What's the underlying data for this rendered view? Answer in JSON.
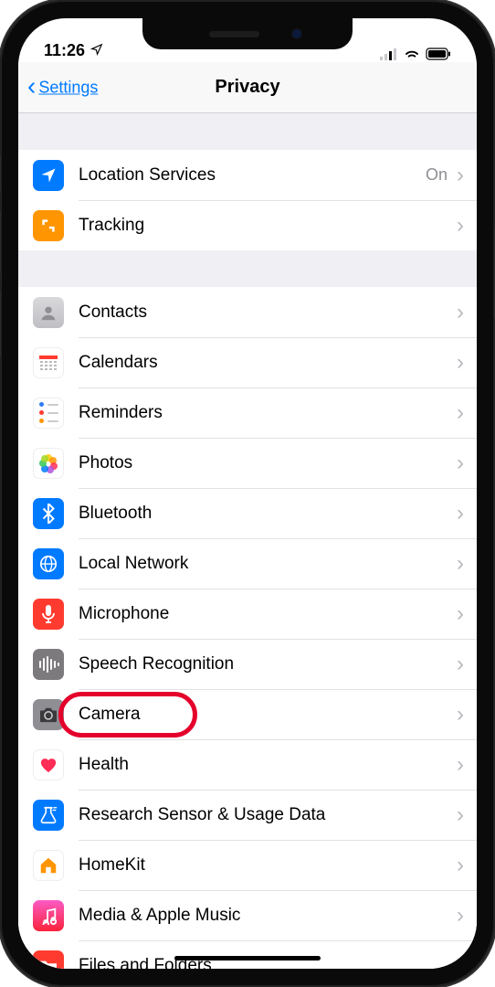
{
  "status": {
    "time": "11:26"
  },
  "nav": {
    "back_label": "Settings",
    "title": "Privacy"
  },
  "groups": [
    {
      "rows": [
        {
          "id": "location-services",
          "icon": "location-arrow-icon",
          "label": "Location Services",
          "value": "On"
        },
        {
          "id": "tracking",
          "icon": "tracking-icon",
          "label": "Tracking"
        }
      ]
    },
    {
      "rows": [
        {
          "id": "contacts",
          "icon": "contacts-icon",
          "label": "Contacts"
        },
        {
          "id": "calendars",
          "icon": "calendar-icon",
          "label": "Calendars"
        },
        {
          "id": "reminders",
          "icon": "reminders-icon",
          "label": "Reminders"
        },
        {
          "id": "photos",
          "icon": "photos-icon",
          "label": "Photos"
        },
        {
          "id": "bluetooth",
          "icon": "bluetooth-icon",
          "label": "Bluetooth"
        },
        {
          "id": "local-network",
          "icon": "network-icon",
          "label": "Local Network"
        },
        {
          "id": "microphone",
          "icon": "microphone-icon",
          "label": "Microphone"
        },
        {
          "id": "speech-recognition",
          "icon": "waveform-icon",
          "label": "Speech Recognition"
        },
        {
          "id": "camera",
          "icon": "camera-icon",
          "label": "Camera",
          "highlight": true
        },
        {
          "id": "health",
          "icon": "heart-icon",
          "label": "Health"
        },
        {
          "id": "research",
          "icon": "research-icon",
          "label": "Research Sensor & Usage Data"
        },
        {
          "id": "homekit",
          "icon": "home-icon",
          "label": "HomeKit"
        },
        {
          "id": "media-music",
          "icon": "music-icon",
          "label": "Media & Apple Music"
        },
        {
          "id": "files-folders",
          "icon": "folder-icon",
          "label": "Files and Folders"
        }
      ]
    }
  ]
}
